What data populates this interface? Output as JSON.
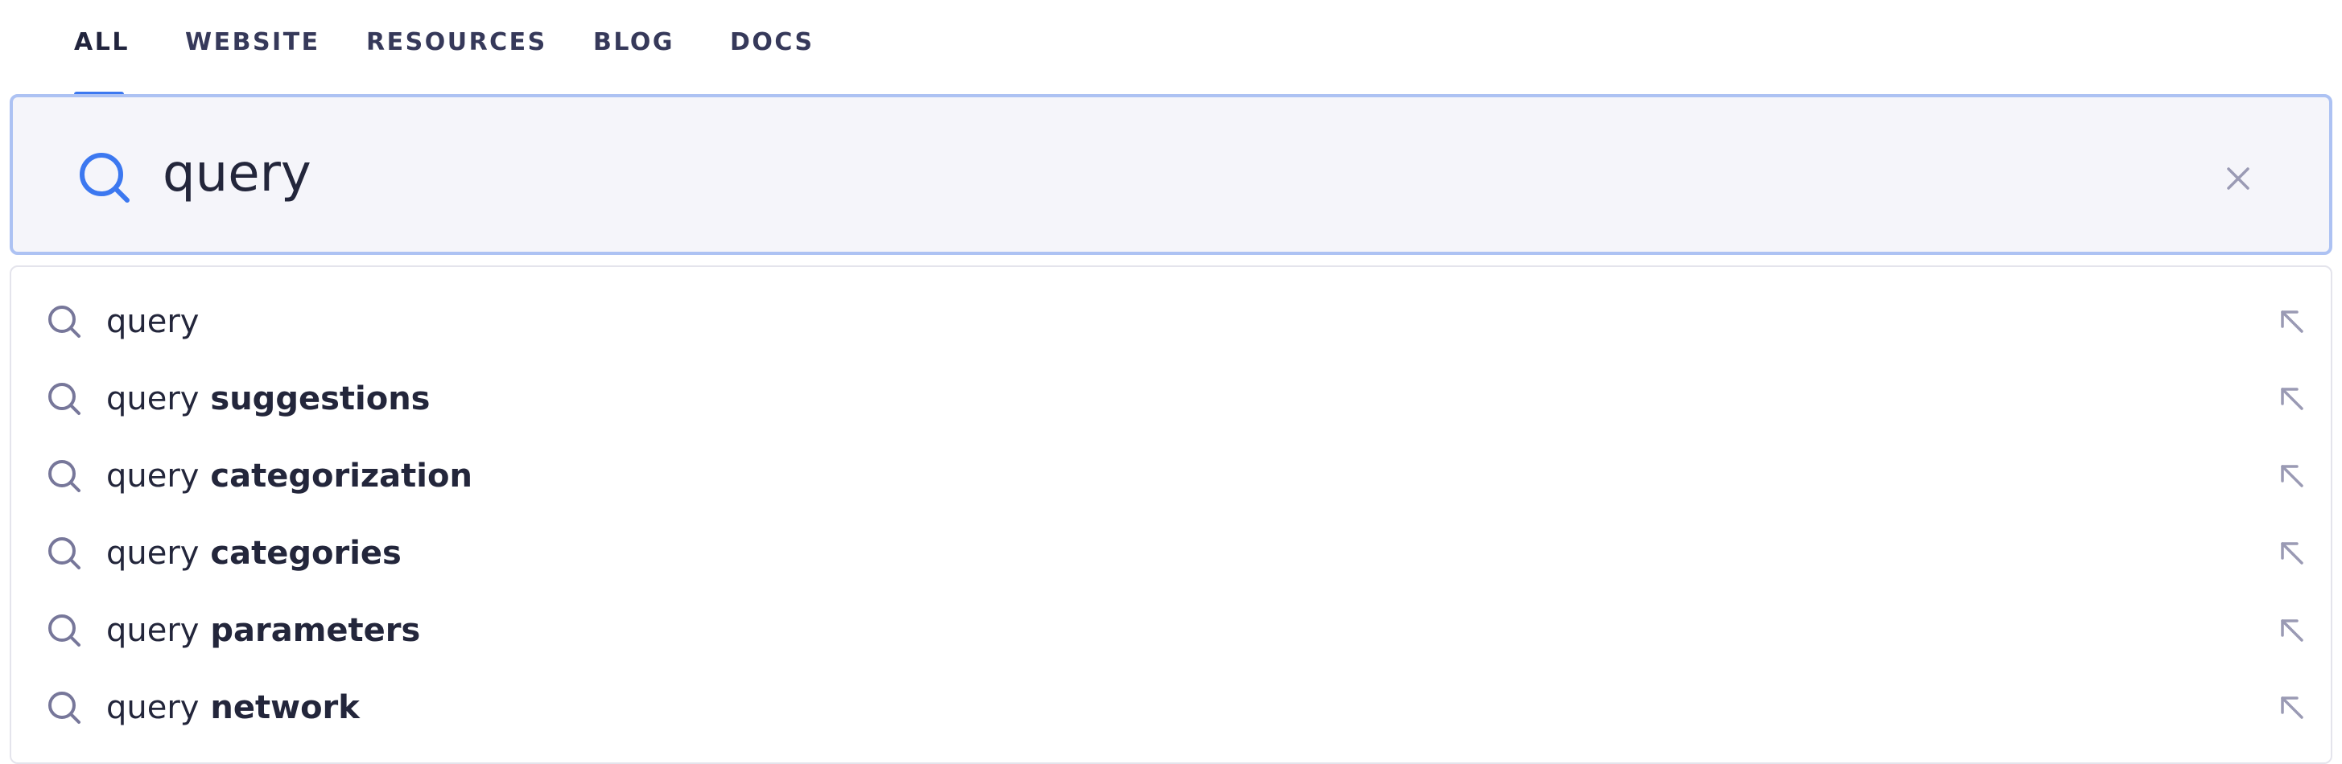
{
  "tabs": [
    {
      "label": "ALL",
      "active": true
    },
    {
      "label": "WEBSITE",
      "active": false
    },
    {
      "label": "RESOURCES",
      "active": false
    },
    {
      "label": "BLOG",
      "active": false
    },
    {
      "label": "DOCS",
      "active": false
    }
  ],
  "search": {
    "value": "query",
    "placeholder": ""
  },
  "suggestions": [
    {
      "base": "query",
      "rest": ""
    },
    {
      "base": "query",
      "rest": " suggestions"
    },
    {
      "base": "query",
      "rest": " categorization"
    },
    {
      "base": "query",
      "rest": " categories"
    },
    {
      "base": "query",
      "rest": " parameters"
    },
    {
      "base": "query",
      "rest": " network"
    }
  ],
  "colors": {
    "accent": "#3c78f0",
    "input_border": "#adc2f3",
    "input_bg": "#f5f5fa",
    "text": "#23263b",
    "icon_muted": "#77779a"
  },
  "icons": {
    "search": "search-icon",
    "clear": "close-icon",
    "fill": "arrow-up-left-icon"
  }
}
